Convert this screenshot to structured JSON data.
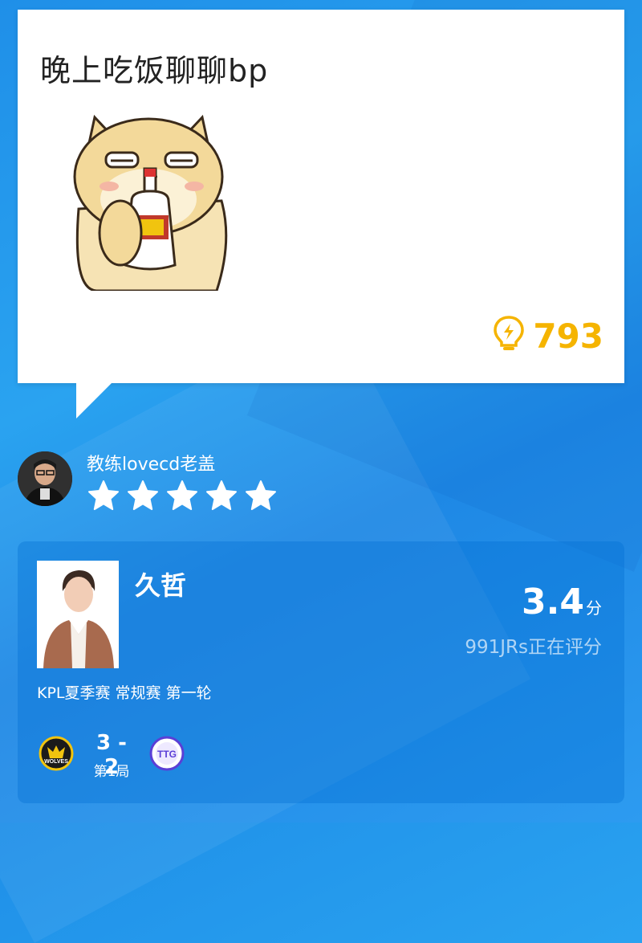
{
  "post": {
    "text": "晚上吃饭聊聊bp",
    "likes": "793",
    "sticker_icon": "shiba-dog-drinking-sticker",
    "like_icon": "lightbulb-lightning-icon",
    "accent_color": "#f5b400"
  },
  "author": {
    "name": "教练lovecd老盖",
    "rating_stars": 5,
    "avatar_icon": "coach-avatar"
  },
  "player_card": {
    "name": "久哲",
    "score": "3.4",
    "score_unit": "分",
    "raters": "991JRs正在评分",
    "match_info": "KPL夏季赛 常规赛 第一轮",
    "match_score": "3 - 2",
    "match_game": "第1局",
    "home_team_icon": "wolves-team-logo",
    "away_team_icon": "ttg-team-logo"
  }
}
